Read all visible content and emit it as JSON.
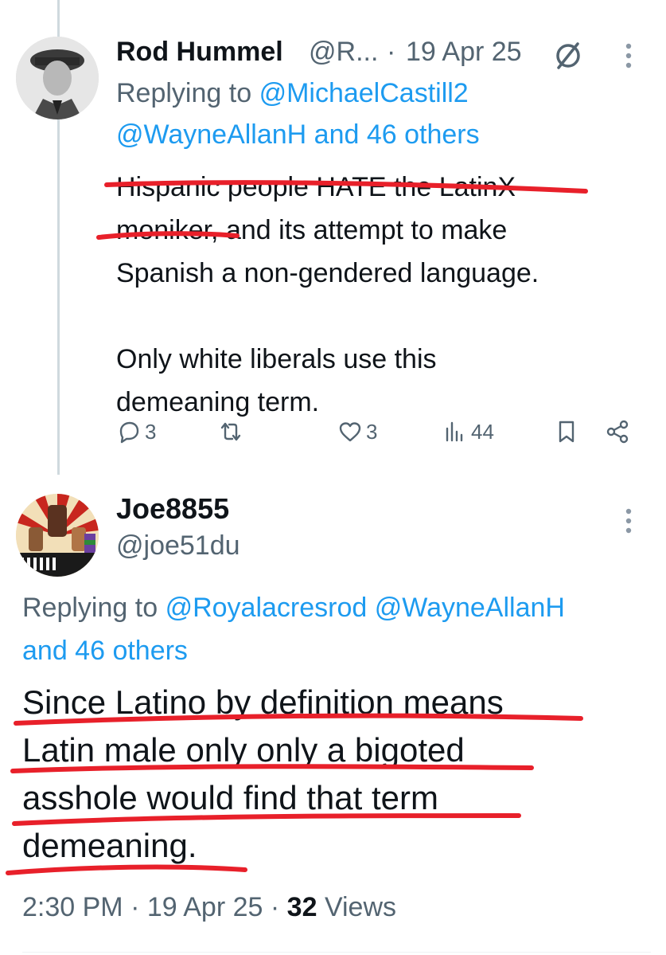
{
  "tweet1": {
    "display_name": "Rod Hummel",
    "handle": "@R...",
    "separator": "·",
    "date": "19 Apr 25",
    "replying_prefix": "Replying to",
    "replying_mention1": "@MichaelCastill2",
    "replying_mention2": "@WayneAllanH and 46 others",
    "body_lines": [
      "Hispanic people HATE the LatinX",
      "moniker, and its attempt to make",
      "Spanish a non-gendered language.",
      "",
      "Only white liberals use this",
      "demeaning term."
    ],
    "stats": {
      "replies": "3",
      "likes": "3",
      "views": "44"
    }
  },
  "tweet2": {
    "display_name": "Joe8855",
    "handle": "@joe51du",
    "avatar_text": "RESIST",
    "replying_prefix": "Replying to",
    "replying_mentions": "@Royalacresrod @WayneAllanH",
    "replying_more": "and 46 others",
    "body_lines": [
      "Since Latino by definition means",
      "Latin male only only a bigoted",
      "asshole would find that term",
      "demeaning."
    ],
    "time": "2:30 PM",
    "separator": "·",
    "date": "19 Apr 25",
    "views_count": "32",
    "views_label": "Views"
  },
  "colors": {
    "link": "#1d9bf0",
    "secondary_text": "#536471",
    "annotation_red": "#e8202a"
  }
}
